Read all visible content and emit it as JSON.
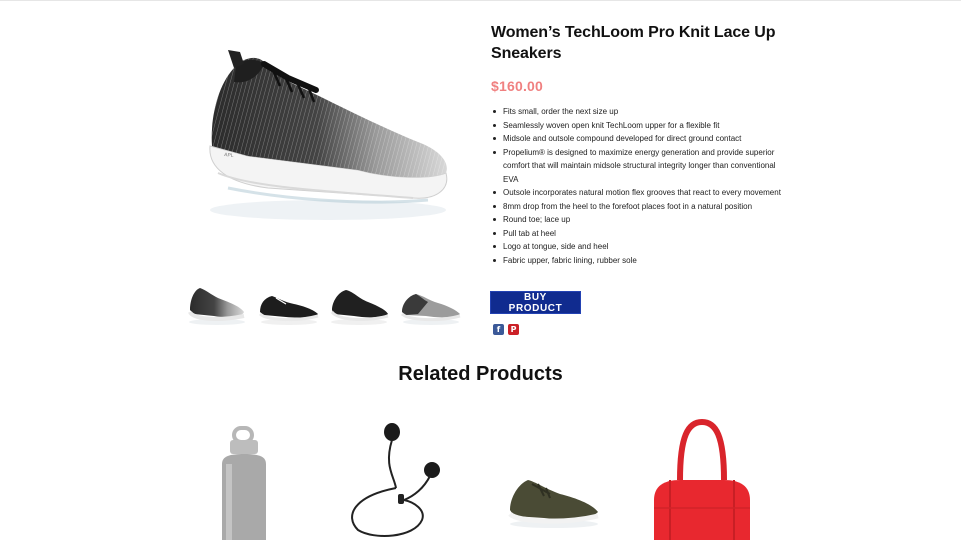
{
  "product": {
    "title": "Women’s TechLoom Pro Knit Lace Up Sneakers",
    "price": "$160.00",
    "features": [
      "Fits small, order the next size up",
      "Seamlessly woven open knit TechLoom upper for a flexible fit",
      "Midsole and outsole compound developed for direct ground contact",
      "Propelium® is designed to maximize energy generation and provide superior comfort that will maintain midsole structural integrity longer than conventional EVA",
      "Outsole incorporates natural motion flex grooves that react to every movement",
      "8mm drop from the heel to the forefoot places foot in a natural position",
      "Round toe; lace up",
      "Pull tab at heel",
      "Logo at tongue, side and heel",
      "Fabric upper, fabric lining, rubber sole"
    ],
    "buy_label": "BUY PRODUCT",
    "main_image_logo": "APL",
    "share": {
      "facebook_glyph": "f",
      "pinterest_glyph": "P"
    }
  },
  "thumbnails": [
    {
      "icon": "sneaker-gradient-thumbnail"
    },
    {
      "icon": "sneaker-black-thumbnail"
    },
    {
      "icon": "sneaker-black-angle-thumbnail"
    },
    {
      "icon": "sneaker-gray-thumbnail"
    }
  ],
  "related": {
    "title": "Related Products",
    "items": [
      {
        "icon": "water-bottle-image"
      },
      {
        "icon": "earbuds-image"
      },
      {
        "icon": "olive-sneaker-image"
      },
      {
        "icon": "red-duffel-bag-image"
      }
    ]
  },
  "colors": {
    "price": "#f08080",
    "buy_button": "#102b8f",
    "facebook": "#3b5998",
    "pinterest": "#cb2027"
  }
}
